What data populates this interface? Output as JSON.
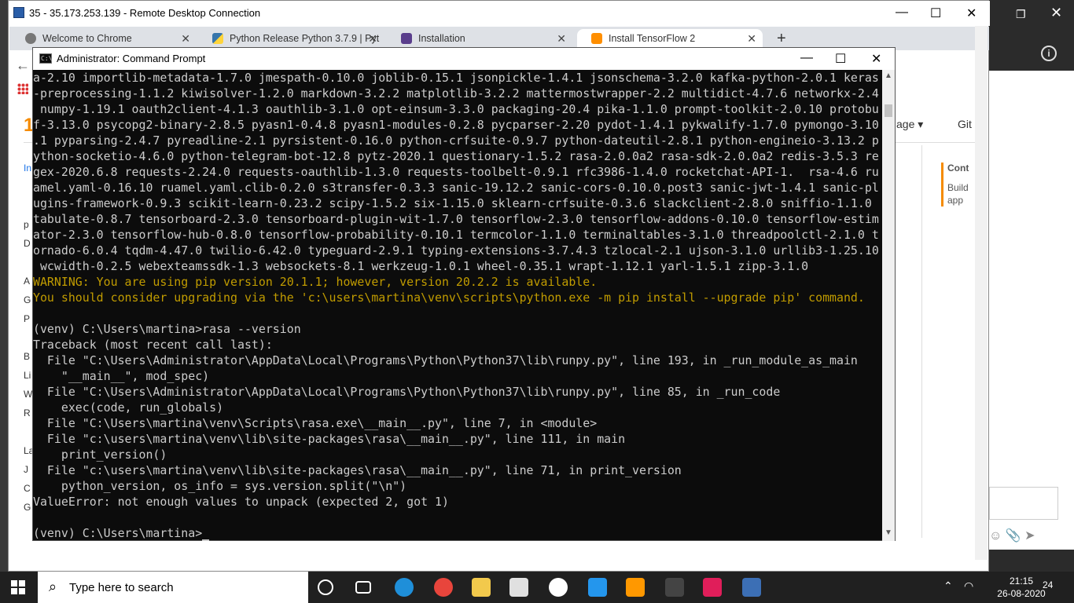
{
  "rdp": {
    "title": "35 - 35.173.253.139 - Remote Desktop Connection",
    "minimize": "—",
    "maximize": "☐",
    "close": "✕"
  },
  "browser": {
    "tabs": [
      {
        "label": "Welcome to Chrome",
        "close": "✕"
      },
      {
        "label": "Python Release Python 3.7.9 | Pyt",
        "close": "✕"
      },
      {
        "label": "Installation",
        "close": "✕"
      },
      {
        "label": "Install TensorFlow 2",
        "close": "✕"
      }
    ],
    "new_tab": "+",
    "back": "←",
    "nav_lang": "age ▾",
    "nav_git": "Git",
    "left_letters": [
      "In",
      "p",
      "D",
      "A",
      "G",
      "P",
      "B",
      "Li",
      "W",
      "R",
      "La",
      "J",
      "C",
      "G"
    ],
    "right_heading": "Cont",
    "right_sub": "Build app"
  },
  "host": {
    "restore": "❐",
    "close": "✕",
    "info": "i",
    "icons": "☺  📎  ➤"
  },
  "cmd": {
    "title": "Administrator: Command Prompt",
    "icon_text": "C:\\",
    "minimize": "—",
    "maximize": "☐",
    "close": "✕",
    "lines": [
      {
        "text": "a-2.10 importlib-metadata-1.7.0 jmespath-0.10.0 joblib-0.15.1 jsonpickle-1.4.1 jsonschema-3.2.0 kafka-python-2.0.1 keras",
        "type": "normal"
      },
      {
        "text": "-preprocessing-1.1.2 kiwisolver-1.2.0 markdown-3.2.2 matplotlib-3.2.2 mattermostwrapper-2.2 multidict-4.7.6 networkx-2.4",
        "type": "normal"
      },
      {
        "text": " numpy-1.19.1 oauth2client-4.1.3 oauthlib-3.1.0 opt-einsum-3.3.0 packaging-20.4 pika-1.1.0 prompt-toolkit-2.0.10 protobu",
        "type": "normal"
      },
      {
        "text": "f-3.13.0 psycopg2-binary-2.8.5 pyasn1-0.4.8 pyasn1-modules-0.2.8 pycparser-2.20 pydot-1.4.1 pykwalify-1.7.0 pymongo-3.10",
        "type": "normal"
      },
      {
        "text": ".1 pyparsing-2.4.7 pyreadline-2.1 pyrsistent-0.16.0 python-crfsuite-0.9.7 python-dateutil-2.8.1 python-engineio-3.13.2 p",
        "type": "normal"
      },
      {
        "text": "ython-socketio-4.6.0 python-telegram-bot-12.8 pytz-2020.1 questionary-1.5.2 rasa-2.0.0a2 rasa-sdk-2.0.0a2 redis-3.5.3 re",
        "type": "normal"
      },
      {
        "text": "gex-2020.6.8 requests-2.24.0 requests-oauthlib-1.3.0 requests-toolbelt-0.9.1 rfc3986-1.4.0 rocketchat-API-1.  rsa-4.6 ru",
        "type": "normal"
      },
      {
        "text": "amel.yaml-0.16.10 ruamel.yaml.clib-0.2.0 s3transfer-0.3.3 sanic-19.12.2 sanic-cors-0.10.0.post3 sanic-jwt-1.4.1 sanic-pl",
        "type": "normal"
      },
      {
        "text": "ugins-framework-0.9.3 scikit-learn-0.23.2 scipy-1.5.2 six-1.15.0 sklearn-crfsuite-0.3.6 slackclient-2.8.0 sniffio-1.1.0",
        "type": "normal"
      },
      {
        "text": "tabulate-0.8.7 tensorboard-2.3.0 tensorboard-plugin-wit-1.7.0 tensorflow-2.3.0 tensorflow-addons-0.10.0 tensorflow-estim",
        "type": "normal"
      },
      {
        "text": "ator-2.3.0 tensorflow-hub-0.8.0 tensorflow-probability-0.10.1 termcolor-1.1.0 terminaltables-3.1.0 threadpoolctl-2.1.0 t",
        "type": "normal"
      },
      {
        "text": "ornado-6.0.4 tqdm-4.47.0 twilio-6.42.0 typeguard-2.9.1 typing-extensions-3.7.4.3 tzlocal-2.1 ujson-3.1.0 urllib3-1.25.10",
        "type": "normal"
      },
      {
        "text": " wcwidth-0.2.5 webexteamssdk-1.3 websockets-8.1 werkzeug-1.0.1 wheel-0.35.1 wrapt-1.12.1 yarl-1.5.1 zipp-3.1.0",
        "type": "normal"
      },
      {
        "text": "WARNING: You are using pip version 20.1.1; however, version 20.2.2 is available.",
        "type": "warn"
      },
      {
        "text": "You should consider upgrading via the 'c:\\users\\martina\\venv\\scripts\\python.exe -m pip install --upgrade pip' command.",
        "type": "warn"
      },
      {
        "text": "",
        "type": "normal"
      },
      {
        "text": "(venv) C:\\Users\\martina>rasa --version",
        "type": "normal"
      },
      {
        "text": "Traceback (most recent call last):",
        "type": "normal"
      },
      {
        "text": "  File \"C:\\Users\\Administrator\\AppData\\Local\\Programs\\Python\\Python37\\lib\\runpy.py\", line 193, in _run_module_as_main",
        "type": "normal"
      },
      {
        "text": "    \"__main__\", mod_spec)",
        "type": "normal"
      },
      {
        "text": "  File \"C:\\Users\\Administrator\\AppData\\Local\\Programs\\Python\\Python37\\lib\\runpy.py\", line 85, in _run_code",
        "type": "normal"
      },
      {
        "text": "    exec(code, run_globals)",
        "type": "normal"
      },
      {
        "text": "  File \"C:\\Users\\martina\\venv\\Scripts\\rasa.exe\\__main__.py\", line 7, in <module>",
        "type": "normal"
      },
      {
        "text": "  File \"c:\\users\\martina\\venv\\lib\\site-packages\\rasa\\__main__.py\", line 111, in main",
        "type": "normal"
      },
      {
        "text": "    print_version()",
        "type": "normal"
      },
      {
        "text": "  File \"c:\\users\\martina\\venv\\lib\\site-packages\\rasa\\__main__.py\", line 71, in print_version",
        "type": "normal"
      },
      {
        "text": "    python_version, os_info = sys.version.split(\"\\n\")",
        "type": "normal"
      },
      {
        "text": "ValueError: not enough values to unpack (expected 2, got 1)",
        "type": "normal"
      },
      {
        "text": "",
        "type": "normal"
      }
    ],
    "prompt": "(venv) C:\\Users\\martina>"
  },
  "taskbar": {
    "search_placeholder": "Type here to search",
    "icons": [
      {
        "name": "cortana-icon",
        "color": "#202020"
      },
      {
        "name": "task-view-icon",
        "color": "#202020"
      },
      {
        "name": "edge-icon",
        "color": "#1f8fd9"
      },
      {
        "name": "chrome-icon",
        "color": "#e8453c"
      },
      {
        "name": "file-explorer-icon",
        "color": "#f2c94c"
      },
      {
        "name": "store-icon",
        "color": "#e0e0e0"
      },
      {
        "name": "cloud-icon",
        "color": "#ffffff"
      },
      {
        "name": "docker-icon",
        "color": "#2496ed"
      },
      {
        "name": "sublime-icon",
        "color": "#ff9800"
      },
      {
        "name": "terminal-icon",
        "color": "#444444"
      },
      {
        "name": "slack-icon",
        "color": "#e01e5a"
      },
      {
        "name": "remote-desktop-icon",
        "color": "#3c6fb5"
      }
    ],
    "time": "21:15",
    "date": "26-08-2020",
    "notifications": "24"
  }
}
